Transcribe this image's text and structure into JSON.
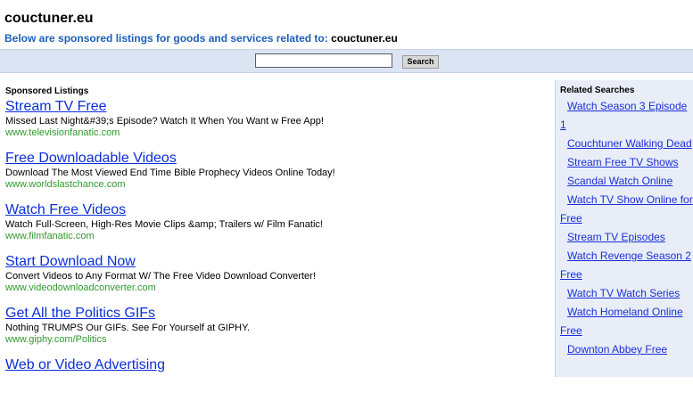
{
  "header": {
    "site_title": "couctuner.eu",
    "subtitle_prefix": "Below are sponsored listings for goods and services related to: ",
    "subtitle_domain": "couctuner.eu"
  },
  "search": {
    "input_value": "",
    "button_label": "Search"
  },
  "listings": {
    "heading": "Sponsored Listings",
    "ads": [
      {
        "title": "Stream TV Free",
        "description": "Missed Last Night&#39;s Episode? Watch It When You Want w Free App!",
        "url": "www.televisionfanatic.com"
      },
      {
        "title": "Free Downloadable Videos",
        "description": "Download The Most Viewed End Time Bible Prophecy Videos Online Today!",
        "url": "www.worldslastchance.com"
      },
      {
        "title": "Watch Free Videos",
        "description": "Watch Full-Screen, High-Res Movie Clips &amp; Trailers w/ Film Fanatic!",
        "url": "www.filmfanatic.com"
      },
      {
        "title": "Start Download Now",
        "description": "Convert Videos to Any Format W/ The Free Video Download Converter!",
        "url": "www.videodownloadconverter.com"
      },
      {
        "title": "Get All the Politics GIFs",
        "description": "Nothing TRUMPS Our GIFs. See For Yourself at GIPHY.",
        "url": "www.giphy.com/Politics"
      },
      {
        "title": "Web or Video Advertising",
        "description": "",
        "url": ""
      }
    ]
  },
  "related": {
    "heading": "Related Searches",
    "items": [
      "Watch Season 3 Episode 1",
      "Couchtuner Walking Dead",
      "Stream Free TV Shows",
      "Scandal Watch Online",
      "Watch TV Show Online for Free",
      "Stream TV Episodes",
      "Watch Revenge Season 2 Free",
      "Watch TV Watch Series",
      "Watch Homeland Online Free",
      "Downton Abbey Free"
    ]
  }
}
